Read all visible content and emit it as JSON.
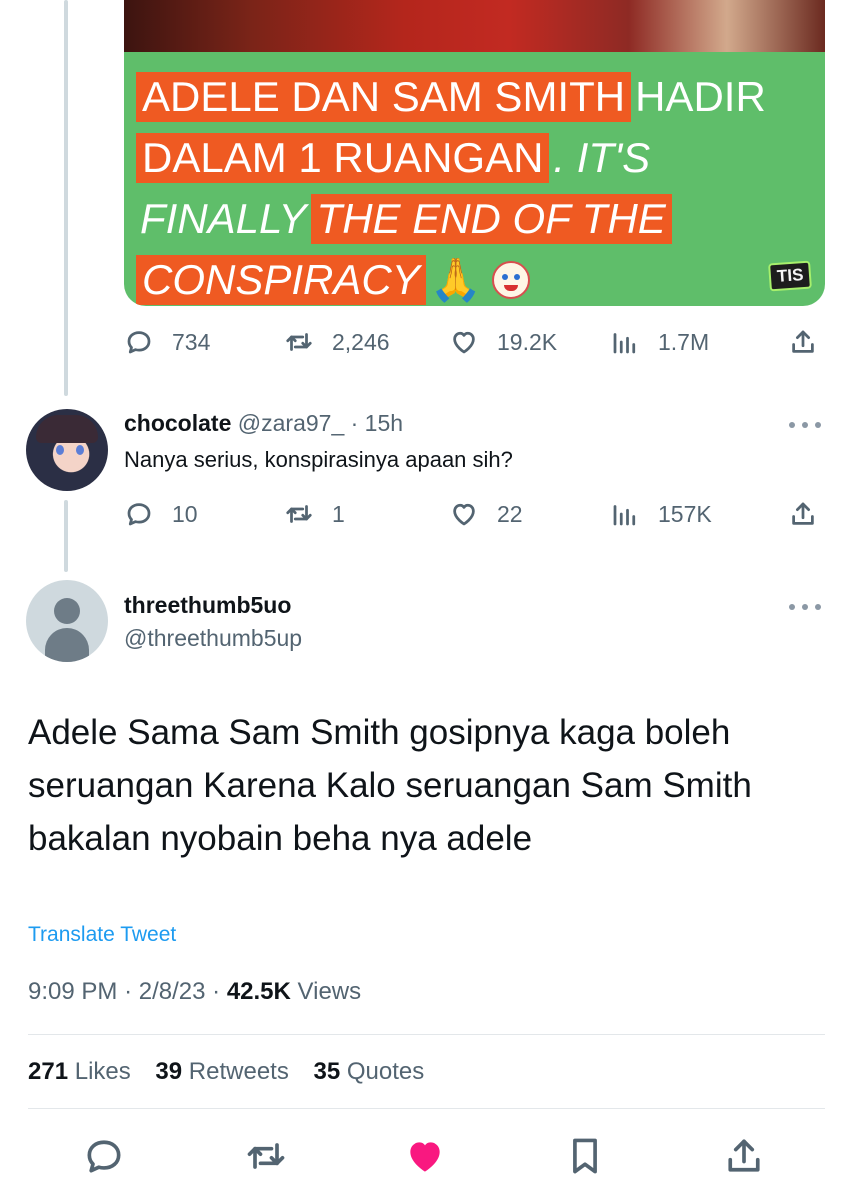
{
  "media": {
    "lines": [
      [
        {
          "text": "ADELE DAN SAM SMITH",
          "style": "hl"
        },
        {
          "text": "HADIR",
          "style": "plain"
        }
      ],
      [
        {
          "text": "DALAM 1 RUANGAN",
          "style": "hl"
        },
        {
          "text": ". IT'S",
          "style": "plain-italic"
        }
      ],
      [
        {
          "text": "FINALLY",
          "style": "plain-italic"
        },
        {
          "text": "THE END OF THE",
          "style": "hl-italic"
        }
      ],
      [
        {
          "text": "CONSPIRACY",
          "style": "hl-italic"
        },
        {
          "text": "🙏",
          "style": "plain"
        }
      ]
    ],
    "logo": "TIS"
  },
  "quoted_tweet_actions": {
    "replies": "734",
    "retweets": "2,246",
    "likes": "19.2K",
    "views": "1.7M"
  },
  "reply": {
    "name": "chocolate",
    "handle": "@zara97_",
    "time": "· 15h",
    "text": "Nanya serius, konspirasinya apaan sih?",
    "actions": {
      "replies": "10",
      "retweets": "1",
      "likes": "22",
      "views": "157K"
    }
  },
  "main_tweet": {
    "name": "threethumb5uo",
    "handle": "@threethumb5up",
    "text": "Adele Sama Sam Smith gosipnya kaga boleh seruangan Karena Kalo seruangan Sam Smith bakalan nyobain beha nya adele",
    "translate_label": "Translate Tweet",
    "time": "9:09 PM",
    "date": "2/8/23",
    "views_count": "42.5K",
    "views_label": "Views",
    "likes_count": "271",
    "likes_label": "Likes",
    "retweets_count": "39",
    "retweets_label": "Retweets",
    "quotes_count": "35",
    "quotes_label": "Quotes"
  },
  "colors": {
    "accent": "#1d9bf0",
    "like_active": "#f91880",
    "muted": "#536471",
    "media_green": "#5fbe6a",
    "media_highlight": "#ef5a22"
  }
}
